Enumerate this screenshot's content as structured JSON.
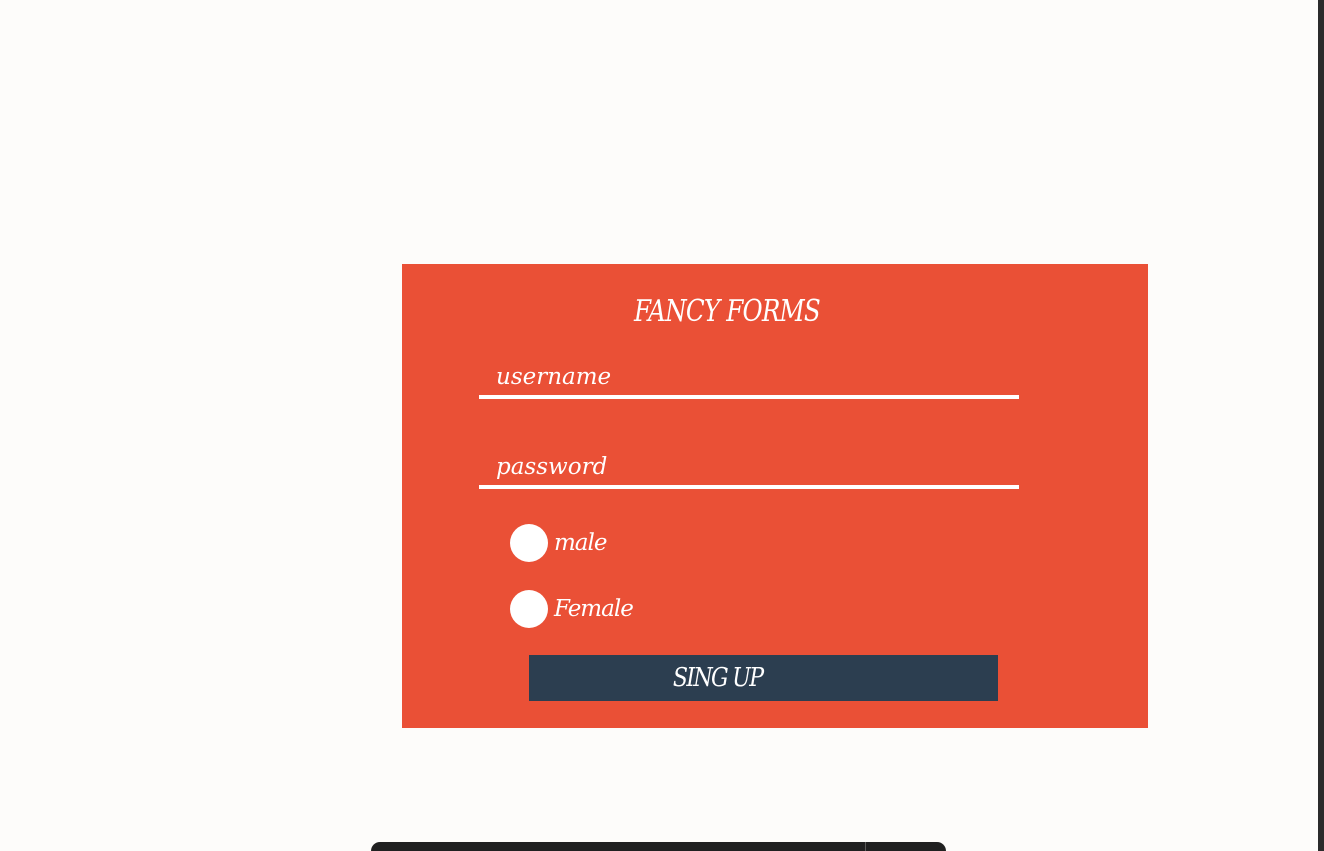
{
  "form": {
    "title": "FANCY FORMS",
    "username_placeholder": "username",
    "password_placeholder": "password",
    "gender_options": [
      "male",
      "Female"
    ],
    "submit_label": "SING UP"
  },
  "colors": {
    "page_background": "#fdfcfa",
    "card_background": "#ea5036",
    "button_background": "#2c3e50",
    "text": "#ffffff"
  }
}
